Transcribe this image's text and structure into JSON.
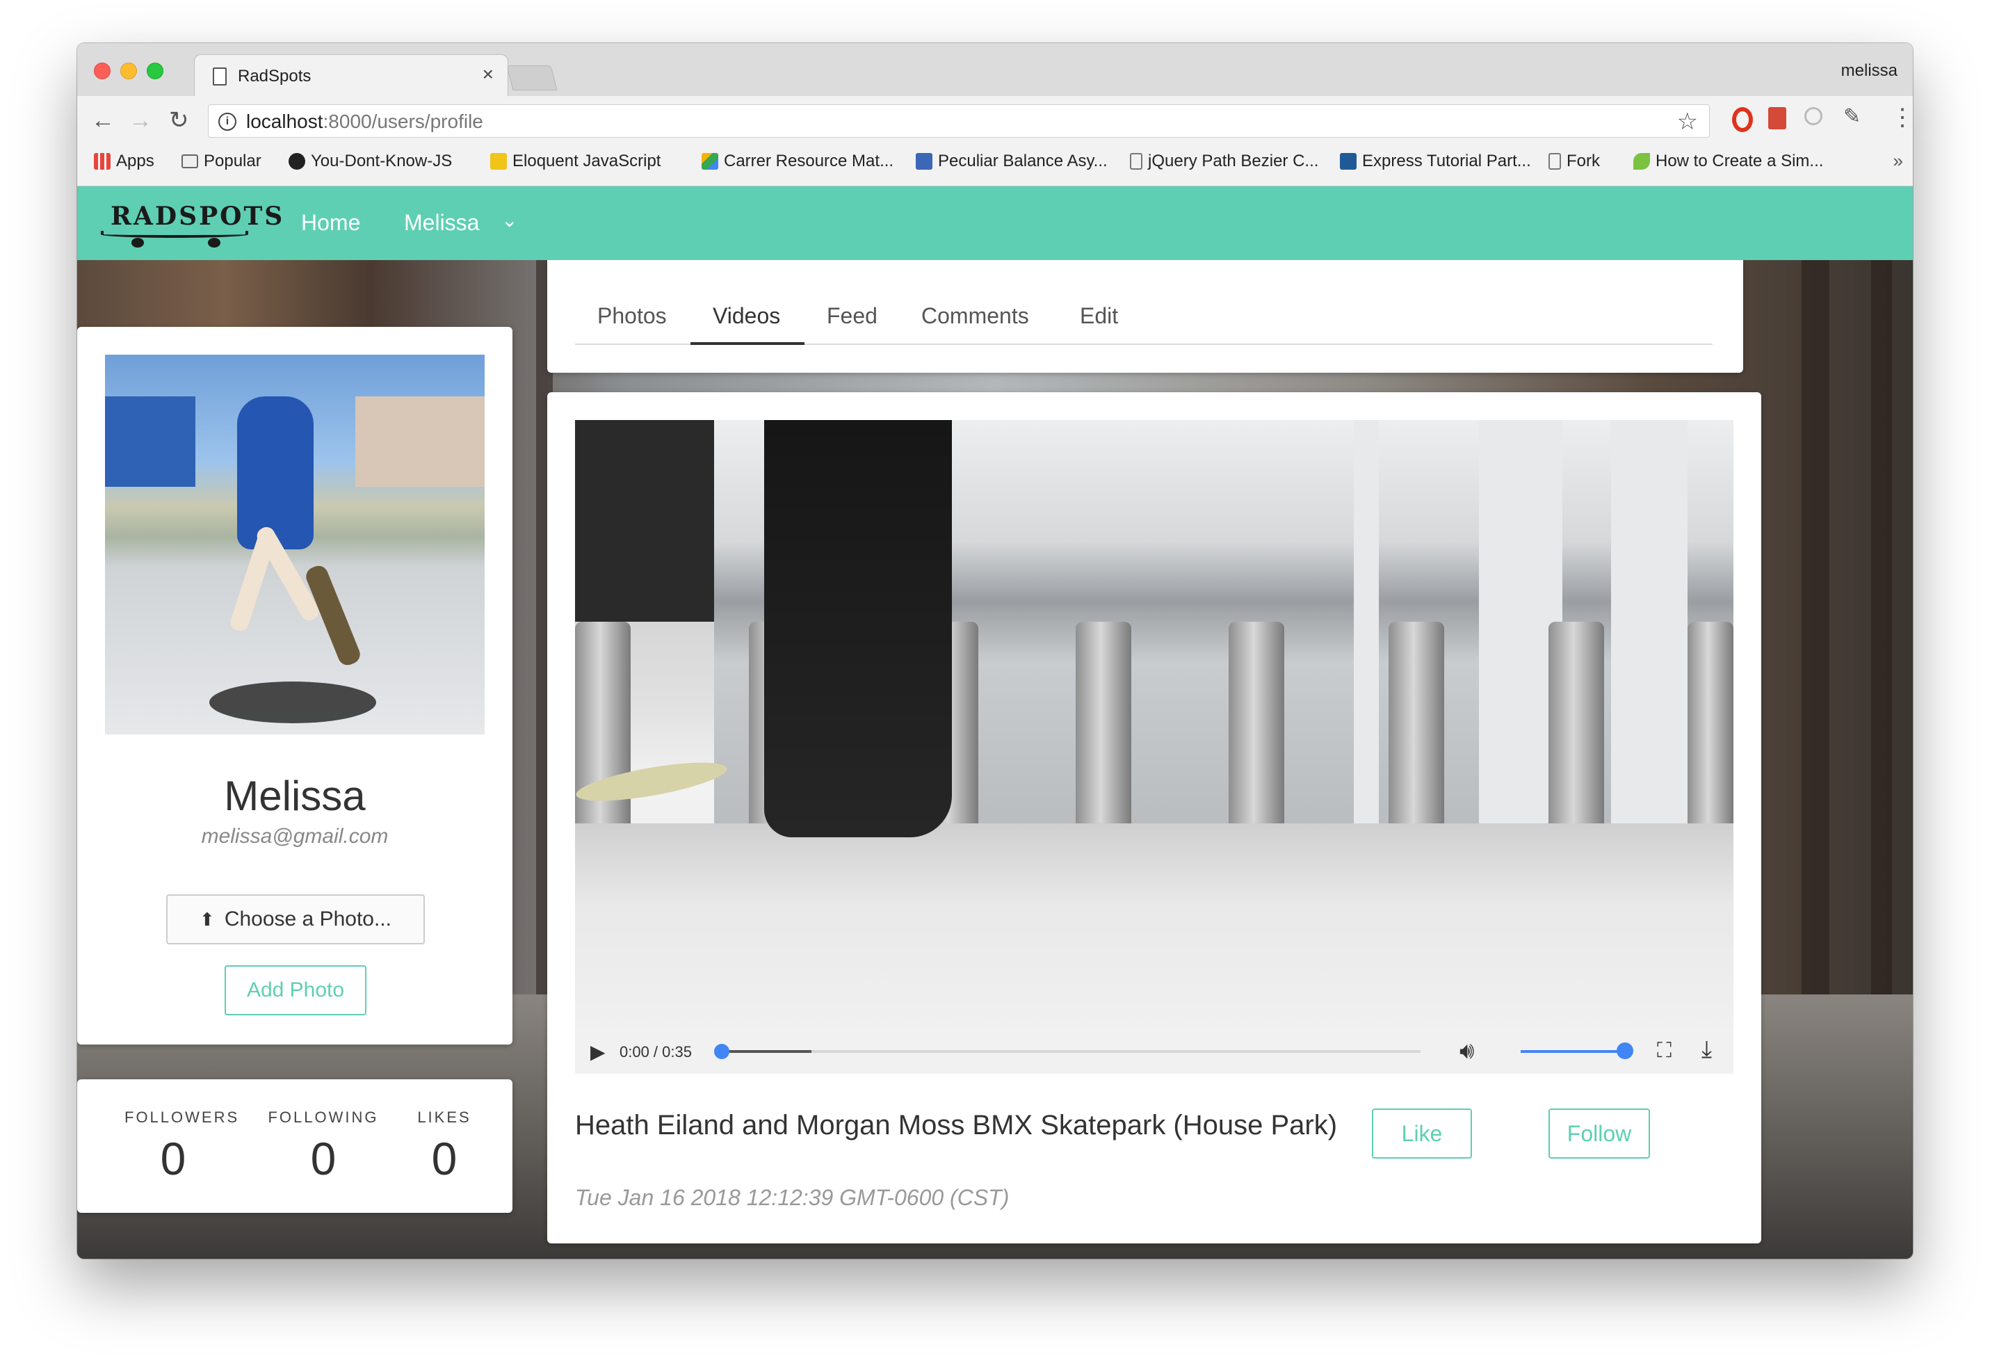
{
  "browser": {
    "tab_title": "RadSpots",
    "tab_close": "×",
    "profile_name": "melissa",
    "url_host": "localhost",
    "url_path": ":8000/users/profile",
    "back": "←",
    "forward": "→",
    "reload": "↻",
    "bookmarks": [
      {
        "label": "Apps",
        "icon": "apps-grid-icon",
        "color": "#e8453c"
      },
      {
        "label": "Popular",
        "icon": "folder-icon",
        "color": "#888888"
      },
      {
        "label": "You-Dont-Know-JS",
        "icon": "github-icon",
        "color": "#222222"
      },
      {
        "label": "Eloquent JavaScript",
        "icon": "ejs-icon",
        "color": "#f0c419"
      },
      {
        "label": "Carrer Resource Mat...",
        "icon": "google-drive-icon",
        "color": "#34a853"
      },
      {
        "label": "Peculiar Balance Asy...",
        "icon": "codewars-icon",
        "color": "#3c66b6"
      },
      {
        "label": "jQuery Path Bezier C...",
        "icon": "page-icon",
        "color": "#888888"
      },
      {
        "label": "Express Tutorial Part...",
        "icon": "mdn-icon",
        "color": "#1f5a96"
      },
      {
        "label": "Fork",
        "icon": "page-icon",
        "color": "#888888"
      },
      {
        "label": "How to Create a Sim...",
        "icon": "leaf-icon",
        "color": "#7cc241"
      }
    ],
    "bookmarks_more": "»"
  },
  "site": {
    "logo_text": "RADSPOTS",
    "nav_home": "Home",
    "nav_user": "Melissa",
    "nav_chevron": "⌄",
    "brand_color": "#5ecfb3"
  },
  "profile": {
    "name": "Melissa",
    "email": "melissa@gmail.com",
    "choose_photo": "Choose a Photo...",
    "add_photo": "Add Photo"
  },
  "stats": [
    {
      "label": "FOLLOWERS",
      "value": "0"
    },
    {
      "label": "FOLLOWING",
      "value": "0"
    },
    {
      "label": "LIKES",
      "value": "0"
    }
  ],
  "tabs": [
    "Photos",
    "Videos",
    "Feed",
    "Comments",
    "Edit"
  ],
  "active_tab": "Videos",
  "video": {
    "time": "0:00 / 0:35",
    "progress": 0.0,
    "volume": 1.0,
    "title": "Heath Eiland and Morgan Moss BMX Skatepark (House Park)",
    "like": "Like",
    "follow": "Follow",
    "date": "Tue Jan 16 2018 12:12:39 GMT-0600 (CST)"
  }
}
